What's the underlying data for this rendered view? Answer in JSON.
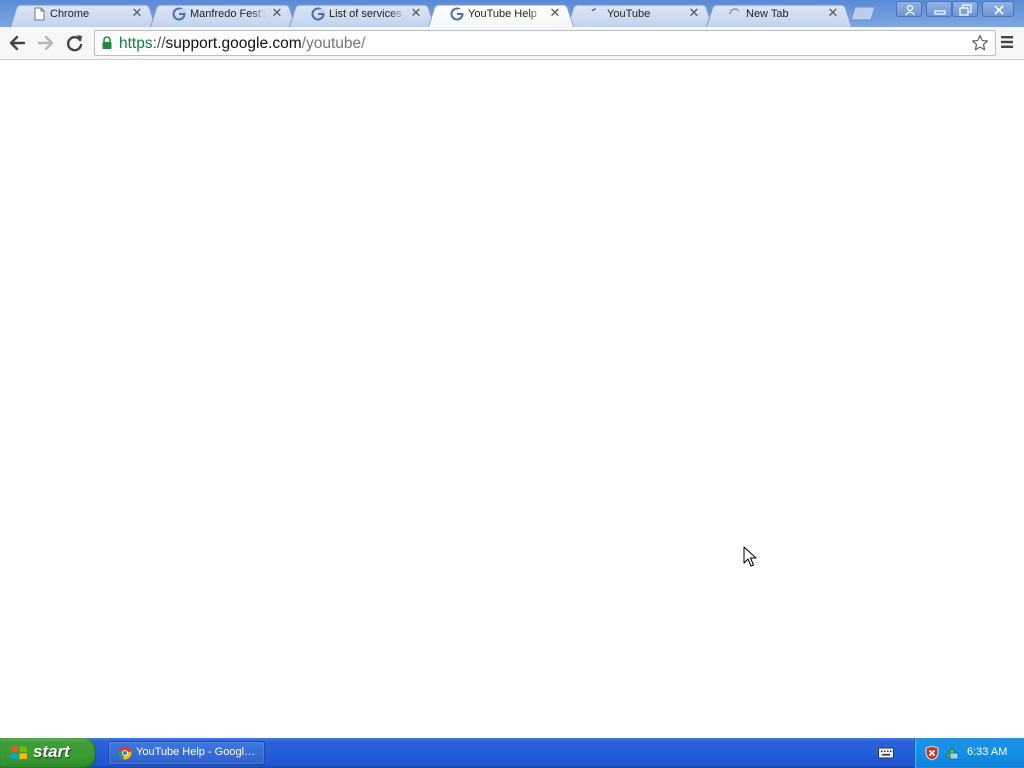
{
  "window": {
    "colors": {
      "titlebar": "#6e96d8",
      "tab_active": "#ffffff",
      "tab_inactive": "#c3d3ee"
    }
  },
  "tabs": [
    {
      "title": "Chrome",
      "favicon": "page-icon",
      "active": false
    },
    {
      "title": "Manfredo Fest's Mo",
      "favicon": "google-g-icon",
      "active": false
    },
    {
      "title": "List of services &",
      "favicon": "google-g-icon",
      "active": false
    },
    {
      "title": "YouTube Help",
      "favicon": "google-g-icon",
      "active": true
    },
    {
      "title": "YouTube",
      "favicon": "loading-icon",
      "active": false
    },
    {
      "title": "New Tab",
      "favicon": "loading-spinner-icon",
      "active": false
    }
  ],
  "toolbar": {
    "url_scheme": "https",
    "url_sep": "://",
    "url_host": "support.google.com",
    "url_path": "/youtube/"
  },
  "taskbar": {
    "start_label": "start",
    "task_label": "YouTube Help - Googl…",
    "clock": "6:33 AM",
    "colors": {
      "taskbar": "#245edb",
      "start": "#3a9a34",
      "tray": "#1290e8"
    }
  }
}
